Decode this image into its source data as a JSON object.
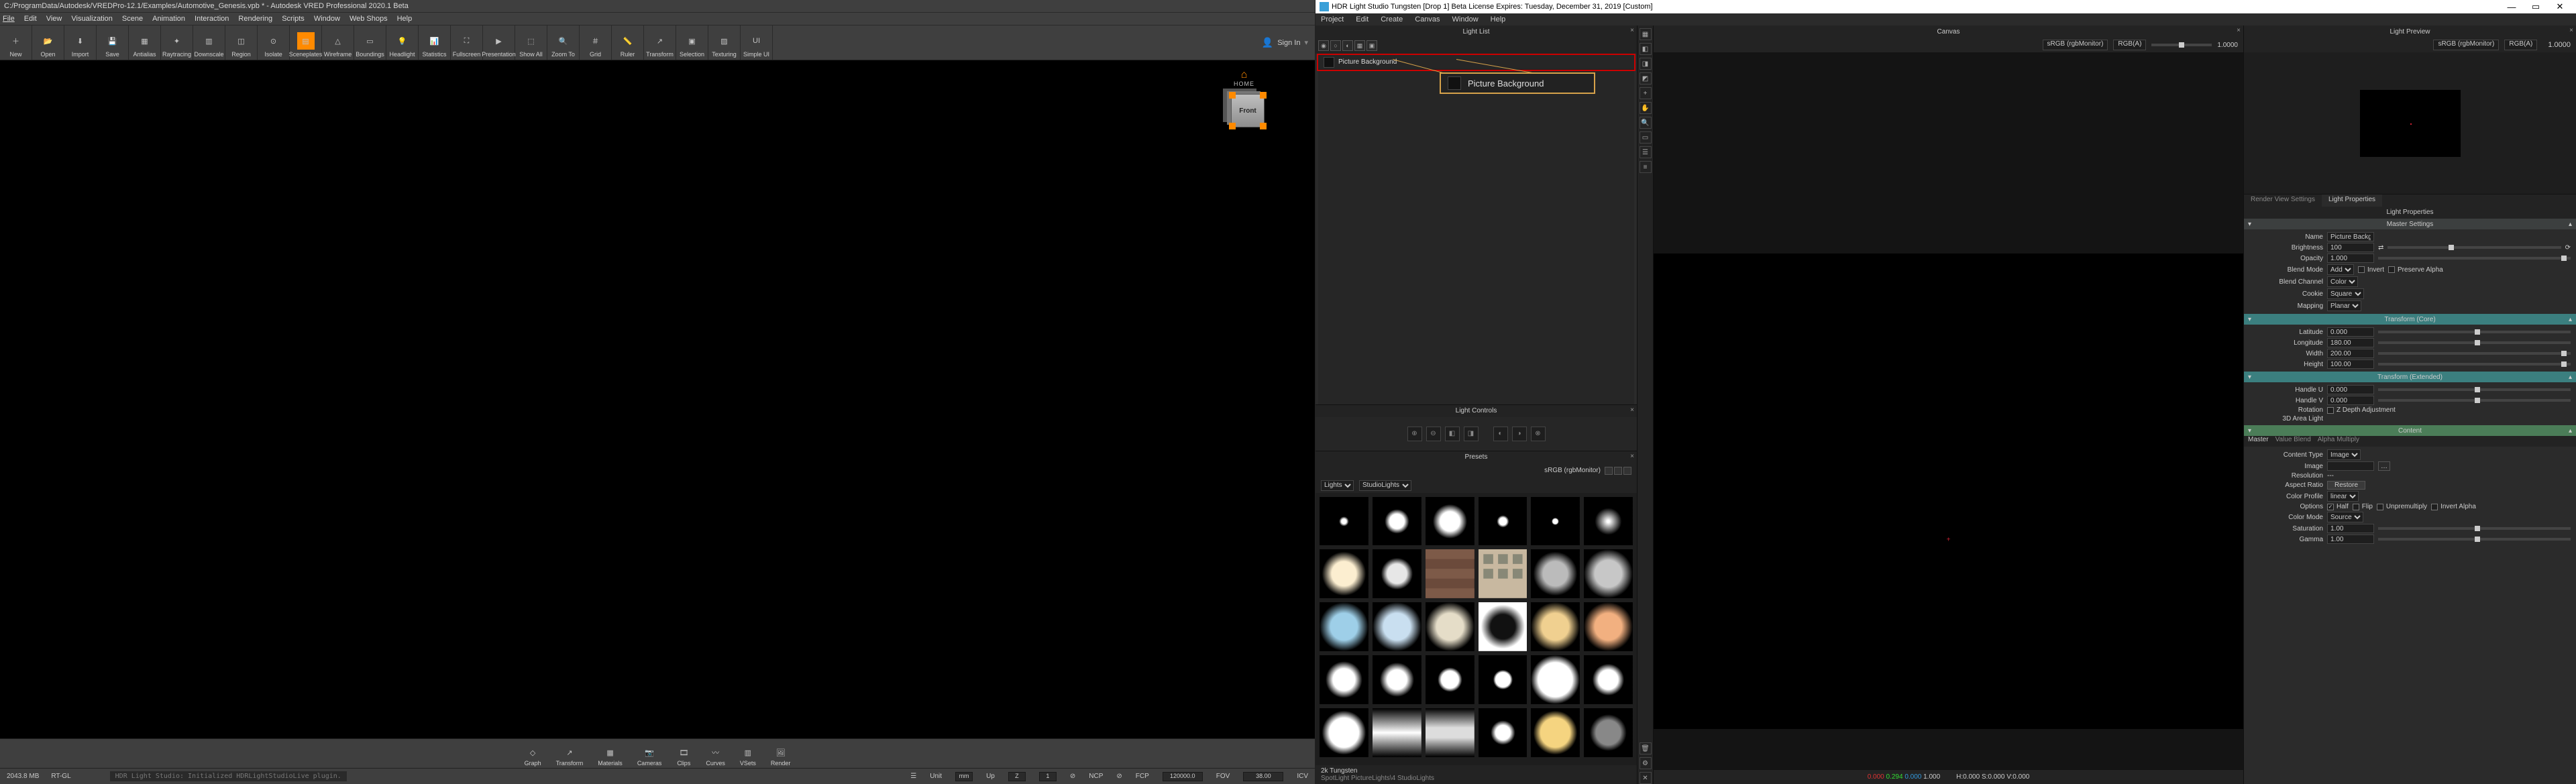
{
  "vred": {
    "title": "C:/ProgramData/Autodesk/VREDPro-12.1/Examples/Automotive_Genesis.vpb * - Autodesk VRED Professional 2020.1 Beta",
    "menu": [
      "File",
      "Edit",
      "View",
      "Visualization",
      "Scene",
      "Animation",
      "Interaction",
      "Rendering",
      "Scripts",
      "Window",
      "Web Shops",
      "Help"
    ],
    "sign_in": "Sign In",
    "toolbar": [
      {
        "icon": "＋",
        "label": "New"
      },
      {
        "icon": "📂",
        "label": "Open"
      },
      {
        "icon": "⬇",
        "label": "Import"
      },
      {
        "icon": "💾",
        "label": "Save"
      },
      {
        "icon": "▦",
        "label": "Antialias"
      },
      {
        "icon": "✦",
        "label": "Raytracing"
      },
      {
        "icon": "▥",
        "label": "Downscale"
      },
      {
        "icon": "◫",
        "label": "Region"
      },
      {
        "icon": "⊙",
        "label": "Isolate"
      },
      {
        "icon": "▤",
        "label": "Sceneplates",
        "active": true
      },
      {
        "icon": "△",
        "label": "Wireframe"
      },
      {
        "icon": "▭",
        "label": "Boundings"
      },
      {
        "icon": "💡",
        "label": "Headlight"
      },
      {
        "icon": "📊",
        "label": "Statistics"
      },
      {
        "icon": "⛶",
        "label": "Fullscreen"
      },
      {
        "icon": "▶",
        "label": "Presentation"
      },
      {
        "icon": "⬚",
        "label": "Show All"
      },
      {
        "icon": "🔍",
        "label": "Zoom To"
      },
      {
        "icon": "＃",
        "label": "Grid"
      },
      {
        "icon": "📏",
        "label": "Ruler"
      },
      {
        "icon": "↗",
        "label": "Transform"
      },
      {
        "icon": "▣",
        "label": "Selection"
      },
      {
        "icon": "▨",
        "label": "Texturing"
      },
      {
        "icon": "UI",
        "label": "Simple UI"
      }
    ],
    "viewcube_face": "Front",
    "home_label": "HOME",
    "bottom_tools": [
      {
        "icon": "◇",
        "label": "Graph"
      },
      {
        "icon": "↗",
        "label": "Transform"
      },
      {
        "icon": "▦",
        "label": "Materials"
      },
      {
        "icon": "📷",
        "label": "Cameras"
      },
      {
        "icon": "🎞",
        "label": "Clips"
      },
      {
        "icon": "〰",
        "label": "Curves"
      },
      {
        "icon": "▥",
        "label": "VSets"
      },
      {
        "icon": "🖼",
        "label": "Render"
      }
    ],
    "status": {
      "mem": "2043.8 MB",
      "gl": "RT-GL",
      "log": "HDR Light Studio: Initialized HDRLightStudioLive plugin.",
      "unit_lbl": "Unit",
      "unit": "mm",
      "up_lbl": "Up",
      "up": "Z",
      "near": "1",
      "ncp_lbl": "NCP",
      "fcp_lbl": "FCP",
      "fcp": "120000.0",
      "fov_lbl": "FOV",
      "fov": "38.00",
      "icv": "ICV"
    }
  },
  "hls": {
    "title": "HDR Light Studio Tungsten [Drop 1] Beta License Expires: Tuesday, December 31, 2019  [Custom]",
    "menu": [
      "Project",
      "Edit",
      "Create",
      "Canvas",
      "Window",
      "Help"
    ],
    "panels": {
      "lightlist": "Light List",
      "lightcontrols": "Light Controls",
      "presets": "Presets",
      "canvas": "Canvas",
      "preview": "Light Preview",
      "rendview": "Render View Settings",
      "lightprops": "Light Properties",
      "lightprops_sub": "Light Properties"
    },
    "lightlist": {
      "item_name": "Picture Background",
      "callout": "Picture Background"
    },
    "colorspace": {
      "label": "sRGB (rgbMonitor)",
      "chan": "RGB(A)",
      "val": "1.0000"
    },
    "presets": {
      "filter1": "Lights",
      "filter2": "StudioLights",
      "crumb1": "2k Tungsten",
      "crumb2": "SpotLight PictureLights\\4 StudioLights"
    },
    "canvas": {
      "rgb": {
        "r": "0.000",
        "g": "0.294",
        "b": "0.000",
        "w": "1.000"
      },
      "coords": "H:0.000 S:0.000 V:0.000"
    },
    "props": {
      "sections": {
        "master": "Master Settings",
        "core": "Transform (Core)",
        "ext": "Transform (Extended)",
        "content": "Content"
      },
      "name_lbl": "Name",
      "name_val": "Picture Background",
      "brightness_lbl": "Brightness",
      "brightness_val": "100",
      "opacity_lbl": "Opacity",
      "opacity_val": "1.000",
      "blendmode_lbl": "Blend Mode",
      "blendmode_val": "Add",
      "invert_lbl": "Invert",
      "preservealpha_lbl": "Preserve Alpha",
      "blendch_lbl": "Blend Channel",
      "blendch_val": "Color",
      "cookie_lbl": "Cookie",
      "cookie_val": "Square",
      "mapping_lbl": "Mapping",
      "mapping_val": "Planar",
      "lat_lbl": "Latitude",
      "lat_val": "0.000",
      "lon_lbl": "Longitude",
      "lon_val": "180.00",
      "width_lbl": "Width",
      "width_val": "200.00",
      "height_lbl": "Height",
      "height_val": "100.00",
      "handleu_lbl": "Handle U",
      "handleu_val": "0.000",
      "handlev_lbl": "Handle V",
      "handlev_val": "0.000",
      "rotation_lbl": "Rotation",
      "zdepth_lbl": "Z Depth Adjustment",
      "area3d_lbl": "3D Area Light",
      "subtabs": [
        "Master",
        "Value Blend",
        "Alpha Multiply"
      ],
      "contenttype_lbl": "Content Type",
      "contenttype_val": "Image",
      "image_lbl": "Image",
      "res_lbl": "Resolution",
      "res_val": "---",
      "aspect_lbl": "Aspect Ratio",
      "aspect_btn": "Restore",
      "cprofile_lbl": "Color Profile",
      "cprofile_val": "linear",
      "options_lbl": "Options",
      "opt_half": "Half",
      "opt_flip": "Flip",
      "opt_unpre": "Unpremultiply",
      "opt_inva": "Invert Alpha",
      "cmode_lbl": "Color Mode",
      "cmode_val": "Source",
      "sat_lbl": "Saturation",
      "sat_val": "1.00",
      "gamma_lbl": "Gamma",
      "gamma_val": "1.00"
    }
  }
}
